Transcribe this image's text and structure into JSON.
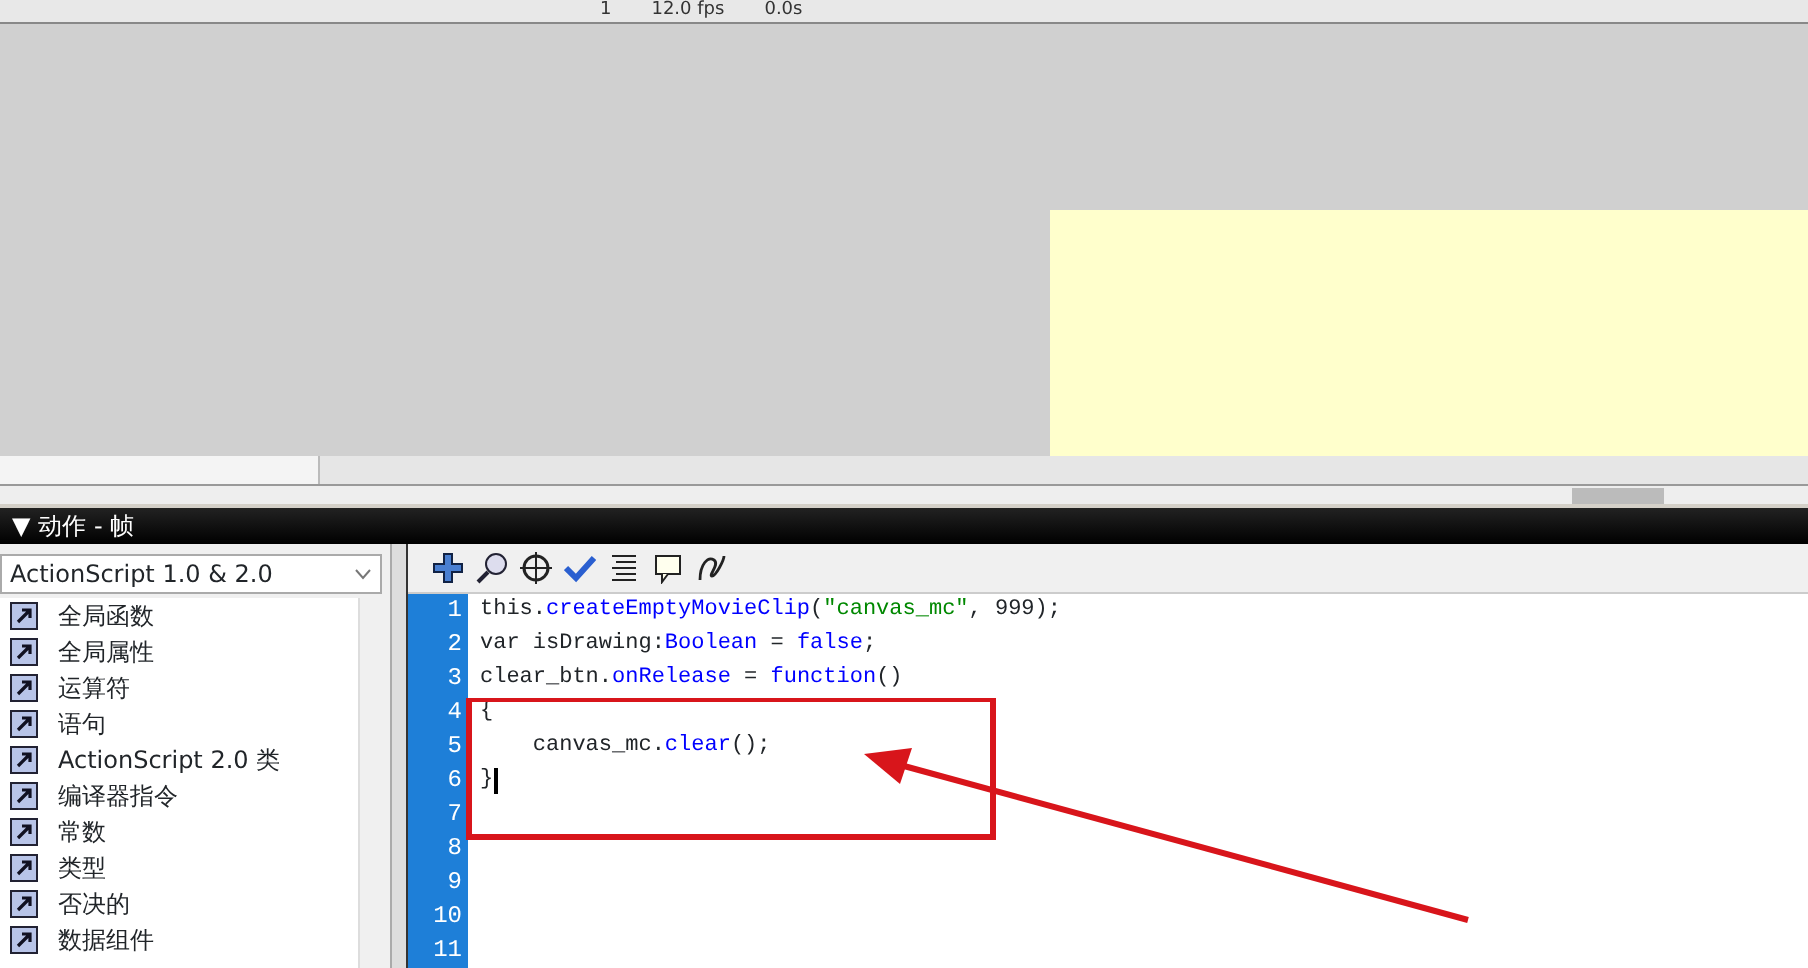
{
  "timeline_toolbar": {
    "frame": "1",
    "frame_rate": "12.0 fps",
    "time": "0.0s"
  },
  "actions_panel": {
    "toggle": "▼",
    "title": "动作 - 帧",
    "language_dropdown": {
      "value": "ActionScript 1.0 & 2.0"
    },
    "toolbox_items": [
      {
        "label": "全局函数"
      },
      {
        "label": "全局属性"
      },
      {
        "label": "运算符"
      },
      {
        "label": "语句"
      },
      {
        "label": "ActionScript 2.0 类"
      },
      {
        "label": "编译器指令"
      },
      {
        "label": "常数"
      },
      {
        "label": "类型"
      },
      {
        "label": "否决的"
      },
      {
        "label": "数据组件"
      }
    ],
    "code_lines": [
      {
        "number": "1",
        "tokens": [
          {
            "kind": "plain",
            "text": "this."
          },
          {
            "kind": "keyword",
            "text": "createEmptyMovieClip"
          },
          {
            "kind": "plain",
            "text": "("
          },
          {
            "kind": "string",
            "text": "\"canvas_mc\""
          },
          {
            "kind": "plain",
            "text": ", 999);"
          }
        ]
      },
      {
        "number": "2",
        "tokens": [
          {
            "kind": "plain",
            "text": "var isDrawing:"
          },
          {
            "kind": "keyword",
            "text": "Boolean"
          },
          {
            "kind": "plain",
            "text": " = "
          },
          {
            "kind": "keyword",
            "text": "false"
          },
          {
            "kind": "plain",
            "text": ";"
          }
        ]
      },
      {
        "number": "3",
        "tokens": [
          {
            "kind": "plain",
            "text": "clear_btn."
          },
          {
            "kind": "keyword",
            "text": "onRelease"
          },
          {
            "kind": "plain",
            "text": " = "
          },
          {
            "kind": "keyword",
            "text": "function"
          },
          {
            "kind": "plain",
            "text": "()"
          }
        ]
      },
      {
        "number": "4",
        "tokens": [
          {
            "kind": "plain",
            "text": "{"
          }
        ]
      },
      {
        "number": "5",
        "tokens": [
          {
            "kind": "plain",
            "text": "    canvas_mc."
          },
          {
            "kind": "keyword",
            "text": "clear"
          },
          {
            "kind": "plain",
            "text": "();"
          }
        ]
      },
      {
        "number": "6",
        "tokens": [
          {
            "kind": "plain",
            "text": "}"
          }
        ],
        "cursor": true
      },
      {
        "number": "7"
      },
      {
        "number": "8"
      },
      {
        "number": "9"
      },
      {
        "number": "10"
      },
      {
        "number": "11"
      }
    ]
  }
}
